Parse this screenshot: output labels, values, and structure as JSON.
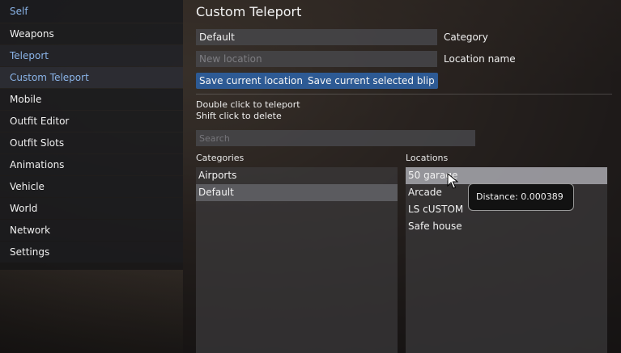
{
  "sidebar": {
    "items": [
      {
        "label": "Self"
      },
      {
        "label": "Weapons"
      },
      {
        "label": "Teleport"
      },
      {
        "label": "Custom Teleport"
      },
      {
        "label": "Mobile"
      },
      {
        "label": "Outfit Editor"
      },
      {
        "label": "Outfit Slots"
      },
      {
        "label": "Animations"
      },
      {
        "label": "Vehicle"
      },
      {
        "label": "World"
      },
      {
        "label": "Network"
      },
      {
        "label": "Settings"
      }
    ]
  },
  "main": {
    "title": "Custom Teleport",
    "category_value": "Default",
    "category_label": "Category",
    "location_placeholder": "New location",
    "location_label": "Location name",
    "save_current_label": "Save current location",
    "save_blip_label": "Save current selected blip",
    "hint_teleport": "Double click to teleport",
    "hint_delete": "Shift click to delete",
    "search_placeholder": "Search",
    "categories_header": "Categories",
    "locations_header": "Locations",
    "categories": [
      {
        "label": "Airports"
      },
      {
        "label": "Default"
      }
    ],
    "locations": [
      {
        "label": "50 garage"
      },
      {
        "label": "Arcade"
      },
      {
        "label": "LS cUSTOM"
      },
      {
        "label": "Safe house"
      }
    ],
    "tooltip": "Distance: 0.000389"
  },
  "colors": {
    "accent_text": "#8ab4e8",
    "button_bg": "#2d5a94"
  }
}
